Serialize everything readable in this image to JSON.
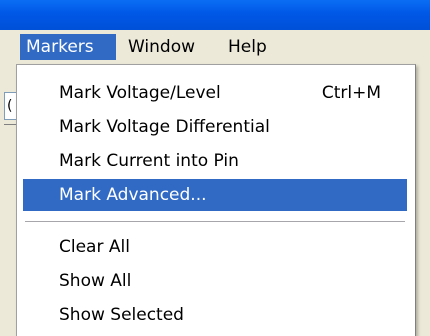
{
  "menubar": {
    "items": [
      {
        "label": "Markers",
        "active": true
      },
      {
        "label": "Window"
      },
      {
        "label": "Help"
      }
    ]
  },
  "toolbar": {
    "partial_button_glyph": "("
  },
  "markers_menu": {
    "items": [
      {
        "label": "Mark Voltage/Level",
        "shortcut": "Ctrl+M"
      },
      {
        "label": "Mark Voltage Differential"
      },
      {
        "label": "Mark Current into Pin"
      },
      {
        "label": "Mark Advanced...",
        "highlighted": true
      },
      {
        "label": "Clear All"
      },
      {
        "label": "Show All"
      },
      {
        "label": "Show Selected"
      }
    ]
  },
  "colors": {
    "title_bar": "#0058e6",
    "menu_background": "#ece9d8",
    "highlight": "#316ac5",
    "dropdown_background": "#ffffff"
  }
}
